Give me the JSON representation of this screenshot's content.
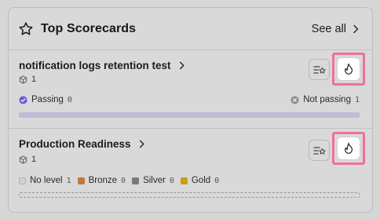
{
  "header": {
    "title": "Top Scorecards",
    "see_all_label": "See all"
  },
  "scorecards": [
    {
      "name": "notification logs retention test",
      "entity_count": "1",
      "passing_label": "Passing",
      "passing_count": "0",
      "not_passing_label": "Not passing",
      "not_passing_count": "1",
      "passing_fraction": 0
    },
    {
      "name": "Production Readiness",
      "entity_count": "1",
      "levels": [
        {
          "label": "No level",
          "count": "1",
          "color": "#cfcfcf"
        },
        {
          "label": "Bronze",
          "count": "0",
          "color": "#c07a3a"
        },
        {
          "label": "Silver",
          "count": "0",
          "color": "#7a7a7a"
        },
        {
          "label": "Gold",
          "count": "0",
          "color": "#c9a10c"
        }
      ]
    }
  ],
  "colors": {
    "accent": "#6b5bd1",
    "highlight": "#ee6f9f",
    "progress_track": "#bfbcd6"
  }
}
